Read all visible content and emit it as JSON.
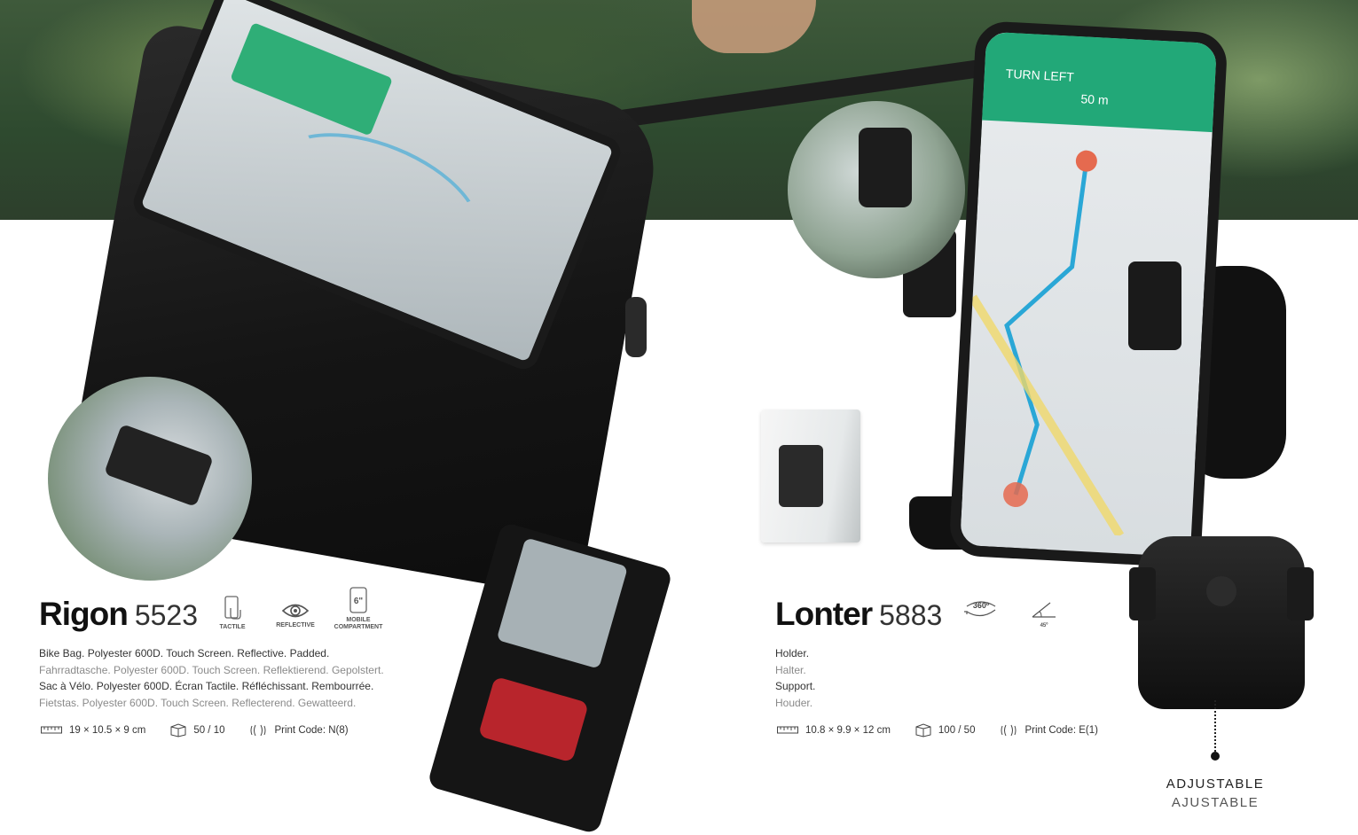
{
  "products": [
    {
      "name": "Rigon",
      "code": "5523",
      "features": [
        {
          "label": "TACTILE",
          "icon": "touchscreen-icon"
        },
        {
          "label": "REFLECTIVE",
          "icon": "eye-icon"
        },
        {
          "label_line1": "MOBILE",
          "label_line2": "COMPARTMENT",
          "icon": "phone-6in-icon",
          "icon_text": "6\""
        }
      ],
      "description": [
        "Bike Bag. Polyester 600D. Touch Screen. Reflective. Padded.",
        "Fahrradtasche. Polyester 600D. Touch Screen. Reflektierend. Gepolstert.",
        "Sac à Vélo. Polyester 600D. Écran Tactile. Réfléchissant. Rembourrée.",
        "Fietstas. Polyester 600D. Touch Screen. Reflecterend. Gewatteerd."
      ],
      "specs": {
        "size": "19 × 10.5 × 9 cm",
        "packing": "50 / 10",
        "print_code": "Print Code: N(8)"
      }
    },
    {
      "name": "Lonter",
      "code": "5883",
      "features": [
        {
          "label": "360º",
          "icon": "rotate-360-icon"
        },
        {
          "label": "45º",
          "icon": "angle-45-icon"
        }
      ],
      "description": [
        "Holder.",
        "Halter.",
        "Support.",
        "Houder."
      ],
      "specs": {
        "size": "10.8 × 9.9 × 12 cm",
        "packing": "100 / 50",
        "print_code": "Print Code: E(1)"
      }
    }
  ],
  "adjustable": {
    "line1": "ADJUSTABLE",
    "line2": "AJUSTABLE"
  },
  "phone_screen": {
    "turn": "TURN LEFT",
    "distance": "50 m"
  },
  "colors": {
    "accent_green": "#22a878",
    "route_blue": "#2aa7d6"
  }
}
